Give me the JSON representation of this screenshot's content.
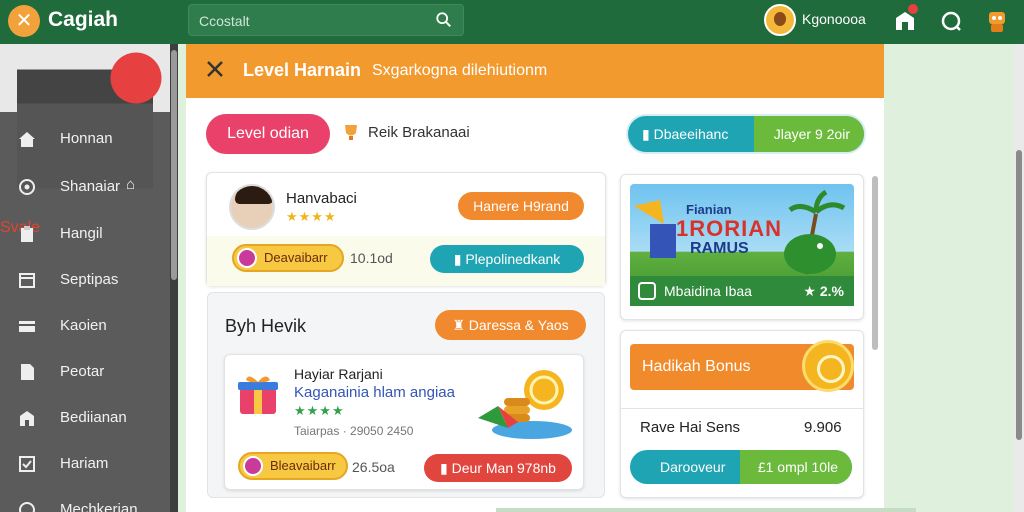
{
  "header": {
    "app_title": "Cagiah",
    "search_placeholder": "Ccostalt",
    "user_name": "Kgonoooa"
  },
  "sidebar": {
    "items": [
      {
        "label": "Svale",
        "active": true,
        "icon": "store-icon"
      },
      {
        "label": "Honnan",
        "icon": "home-icon"
      },
      {
        "label": "Shanaiar",
        "icon": "target-icon"
      },
      {
        "label": "Hangil",
        "icon": "box-icon"
      },
      {
        "label": "Septipas",
        "icon": "calendar-icon"
      },
      {
        "label": "Kaoien",
        "icon": "card-icon"
      },
      {
        "label": "Peotar",
        "icon": "document-icon"
      },
      {
        "label": "Bediianan",
        "icon": "building-icon"
      },
      {
        "label": "Hariam",
        "icon": "checklist-icon"
      },
      {
        "label": "Mechkerian",
        "icon": "compass-icon"
      }
    ]
  },
  "panel": {
    "title": "Level Harnain",
    "subtitle": "Sxgarkogna dilehiutionm",
    "level_pill": "Level odian",
    "rank_label": "Reik Brakanaai",
    "toggle_left": "Dbaeeihanc",
    "toggle_right": "Jlayer 9 2oir"
  },
  "player_card": {
    "name": "Hanvabaci",
    "rating": "★★★★",
    "action": "Hanere H9rand",
    "badge": "Deavaibarr",
    "value": "10.1od",
    "button": "Plepolinedkank"
  },
  "section": {
    "title": "Byh Hevik",
    "action": "Daressa & Yaos",
    "item": {
      "title": "Hayiar Rarjani",
      "subtitle": "Kaganainia hlam angiaa",
      "rating": "★★★★",
      "meta": "Taiarpas · 29050 2450",
      "badge": "Bleavaibarr",
      "value": "26.5oa",
      "button": "Deur Man 978nb"
    }
  },
  "promo": {
    "title_top": "Fianian",
    "title_main": "1RORIAN",
    "title_bottom": "RAMUS",
    "bar_label": "Mbaidina Ibaa",
    "bar_value": "★ 2.%"
  },
  "bonus": {
    "header": "Hadikah Bonus",
    "row_label": "Rave Hai Sens",
    "row_value": "9.906",
    "btn_left": "Darooveur",
    "btn_right": "£1 ompl 10le"
  },
  "colors": {
    "topbar": "#1f6b3c",
    "accent_orange": "#f39a2e",
    "accent_teal": "#1fa4b4",
    "accent_green": "#6cba3c",
    "accent_pink": "#e9416a"
  }
}
